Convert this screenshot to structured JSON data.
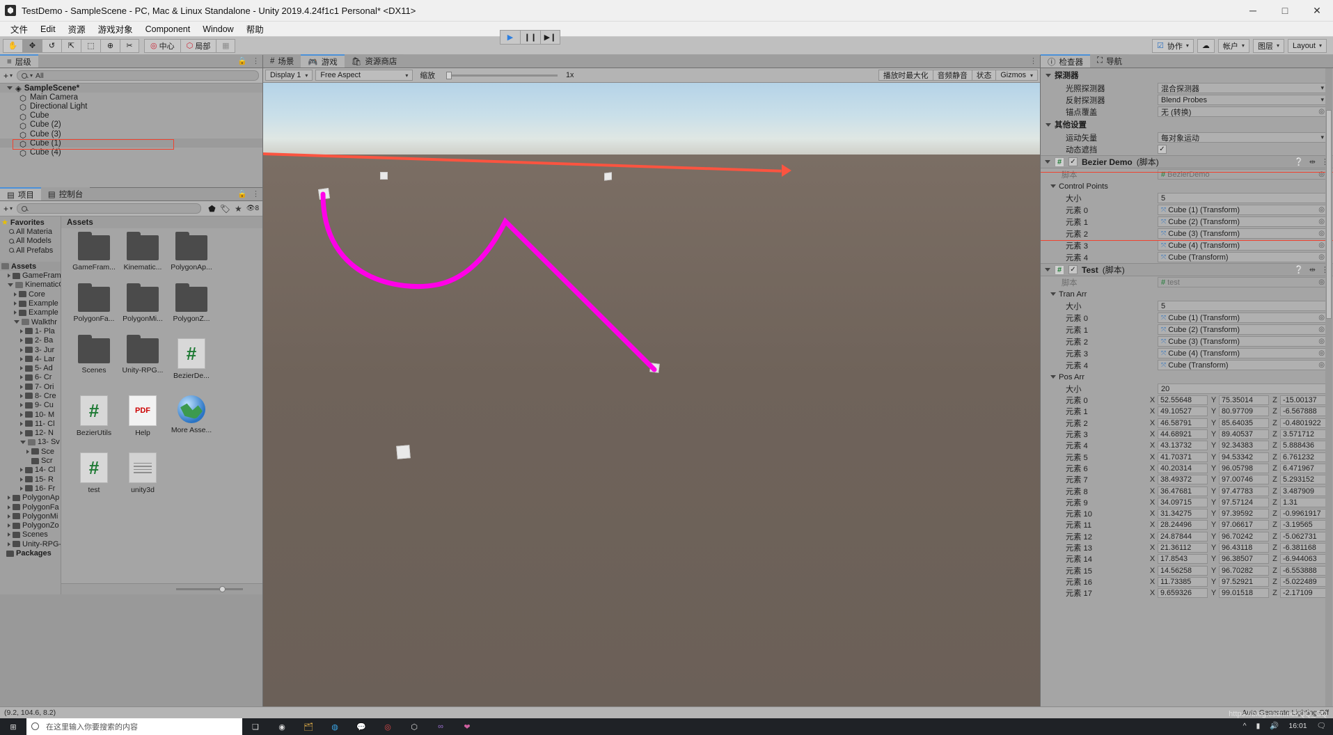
{
  "window": {
    "title": "TestDemo - SampleScene - PC, Mac & Linux Standalone - Unity 2019.4.24f1c1 Personal* <DX11>",
    "minimize": "─",
    "maximize": "□",
    "close": "✕"
  },
  "menubar": [
    "文件",
    "Edit",
    "资源",
    "游戏对象",
    "Component",
    "Window",
    "帮助"
  ],
  "toolbar": {
    "tools": [
      "hand-tool",
      "move-tool",
      "rotate-tool",
      "scale-tool",
      "rect-tool",
      "transform-tool",
      "custom-tool"
    ],
    "pivot": "中心",
    "space": "局部",
    "snap": "snap",
    "play": "▶",
    "pause": "❙❙",
    "step": "▶❙",
    "collab": "协作",
    "cloud": "cloud",
    "account": "帐户",
    "layers": "图层",
    "layout": "Layout"
  },
  "hierarchy": {
    "tab": "层级",
    "add_label": "+",
    "search_placeholder": "All",
    "scene": "SampleScene*",
    "items": [
      {
        "label": "Main Camera",
        "selected": false
      },
      {
        "label": "Directional Light",
        "selected": false
      },
      {
        "label": "Cube",
        "selected": false
      },
      {
        "label": "Cube (2)",
        "selected": false
      },
      {
        "label": "Cube (3)",
        "selected": false
      },
      {
        "label": "Cube (1)",
        "selected": true
      },
      {
        "label": "Cube (4)",
        "selected": false
      }
    ]
  },
  "project": {
    "tabs": [
      {
        "label": "项目",
        "active": true
      },
      {
        "label": "控制台",
        "active": false
      }
    ],
    "search_placeholder": "",
    "count_badge": "8",
    "breadcrumb": "Assets",
    "favorites_label": "Favorites",
    "favorites": [
      "All Materia",
      "All Models",
      "All Prefabs"
    ],
    "tree": [
      {
        "label": "Assets",
        "depth": 0,
        "arrow": "open-folder",
        "bold": true,
        "selected": true
      },
      {
        "label": "GameFram",
        "depth": 1,
        "arrow": "closed"
      },
      {
        "label": "KinematicC",
        "depth": 1,
        "arrow": "open"
      },
      {
        "label": "Core",
        "depth": 2,
        "arrow": "closed"
      },
      {
        "label": "Example",
        "depth": 2,
        "arrow": "closed"
      },
      {
        "label": "Example",
        "depth": 2,
        "arrow": "closed"
      },
      {
        "label": "Walkthr",
        "depth": 2,
        "arrow": "open"
      },
      {
        "label": "1- Pla",
        "depth": 3,
        "arrow": "closed"
      },
      {
        "label": "2- Ba",
        "depth": 3,
        "arrow": "closed"
      },
      {
        "label": "3- Jur",
        "depth": 3,
        "arrow": "closed"
      },
      {
        "label": "4- Lar",
        "depth": 3,
        "arrow": "closed"
      },
      {
        "label": "5- Ad",
        "depth": 3,
        "arrow": "closed"
      },
      {
        "label": "6- Cr",
        "depth": 3,
        "arrow": "closed"
      },
      {
        "label": "7- Ori",
        "depth": 3,
        "arrow": "closed"
      },
      {
        "label": "8- Cre",
        "depth": 3,
        "arrow": "closed"
      },
      {
        "label": "9- Cu",
        "depth": 3,
        "arrow": "closed"
      },
      {
        "label": "10- M",
        "depth": 3,
        "arrow": "closed"
      },
      {
        "label": "11- Cl",
        "depth": 3,
        "arrow": "closed"
      },
      {
        "label": "12- N",
        "depth": 3,
        "arrow": "closed"
      },
      {
        "label": "13- Sv",
        "depth": 3,
        "arrow": "open"
      },
      {
        "label": "Sce",
        "depth": 4,
        "arrow": "closed"
      },
      {
        "label": "Scr",
        "depth": 4,
        "arrow": "none"
      },
      {
        "label": "14- Cl",
        "depth": 3,
        "arrow": "closed"
      },
      {
        "label": "15- R",
        "depth": 3,
        "arrow": "closed"
      },
      {
        "label": "16- Fr",
        "depth": 3,
        "arrow": "closed"
      },
      {
        "label": "PolygonAp",
        "depth": 1,
        "arrow": "closed"
      },
      {
        "label": "PolygonFa",
        "depth": 1,
        "arrow": "closed"
      },
      {
        "label": "PolygonMi",
        "depth": 1,
        "arrow": "closed"
      },
      {
        "label": "PolygonZo",
        "depth": 1,
        "arrow": "closed"
      },
      {
        "label": "Scenes",
        "depth": 1,
        "arrow": "closed"
      },
      {
        "label": "Unity-RPG-",
        "depth": 1,
        "arrow": "closed"
      },
      {
        "label": "Packages",
        "depth": 0,
        "arrow": "none",
        "bold": true
      }
    ],
    "assets": [
      {
        "label": "GameFram...",
        "type": "folder"
      },
      {
        "label": "Kinematic...",
        "type": "folder"
      },
      {
        "label": "PolygonAp...",
        "type": "folder"
      },
      {
        "label": "PolygonFa...",
        "type": "folder"
      },
      {
        "label": "PolygonMi...",
        "type": "folder"
      },
      {
        "label": "PolygonZ...",
        "type": "folder"
      },
      {
        "label": "Scenes",
        "type": "folder"
      },
      {
        "label": "Unity-RPG...",
        "type": "folder"
      },
      {
        "label": "BezierDe...",
        "type": "script",
        "glyph": "#"
      },
      {
        "label": "BezierUtils",
        "type": "script",
        "glyph": "#"
      },
      {
        "label": "Help",
        "type": "pdf",
        "glyph": "PDF"
      },
      {
        "label": "More Asse...",
        "type": "globe"
      },
      {
        "label": "test",
        "type": "script",
        "glyph": "#"
      },
      {
        "label": "unity3d",
        "type": "text"
      }
    ]
  },
  "gameview": {
    "tabs": [
      {
        "label": "场景",
        "icon": "grid-icon",
        "active": false
      },
      {
        "label": "游戏",
        "icon": "gamepad-icon",
        "active": true
      },
      {
        "label": "资源商店",
        "icon": "store-icon",
        "active": false
      }
    ],
    "display": "Display 1",
    "aspect": "Free Aspect",
    "scale_label": "缩放",
    "scale_value": "1x",
    "maximize_on_play": "播放时最大化",
    "mute_audio": "音频静音",
    "stats": "状态",
    "gizmos": "Gizmos"
  },
  "inspector": {
    "tabs": [
      {
        "label": "检查器",
        "icon": "info-icon",
        "active": true
      },
      {
        "label": "导航",
        "icon": "nav-icon",
        "active": false
      }
    ],
    "sections": [
      {
        "title": "探测器",
        "rows": [
          {
            "label": "光照探测器",
            "value": "混合探测器",
            "kind": "dropdown"
          },
          {
            "label": "反射探测器",
            "value": "Blend Probes",
            "kind": "dropdown"
          },
          {
            "label": "锚点覆盖",
            "value": "无 (转换)",
            "kind": "object"
          }
        ]
      },
      {
        "title": "其他设置",
        "rows": [
          {
            "label": "运动矢量",
            "value": "每对象运动",
            "kind": "dropdown"
          },
          {
            "label": "动态遮挡",
            "value": "✓",
            "kind": "checkbox"
          }
        ]
      }
    ],
    "bezier": {
      "component_name": "Bezier Demo",
      "component_suffix": "(脚本)",
      "script_label": "脚本",
      "script_value": "BezierDemo",
      "array_label": "Control Points",
      "size_label": "大小",
      "size_value": "5",
      "elements": [
        {
          "label": "元素 0",
          "value": "Cube (1) (Transform)"
        },
        {
          "label": "元素 1",
          "value": "Cube (2) (Transform)"
        },
        {
          "label": "元素 2",
          "value": "Cube (3) (Transform)"
        },
        {
          "label": "元素 3",
          "value": "Cube (4) (Transform)"
        },
        {
          "label": "元素 4",
          "value": "Cube (Transform)"
        }
      ]
    },
    "test": {
      "component_name": "Test",
      "component_suffix": "(脚本)",
      "script_label": "脚本",
      "script_value": "test",
      "tran_arr_label": "Tran Arr",
      "tran_size_label": "大小",
      "tran_size_value": "5",
      "tran_elements": [
        {
          "label": "元素 0",
          "value": "Cube (1) (Transform)"
        },
        {
          "label": "元素 1",
          "value": "Cube (2) (Transform)"
        },
        {
          "label": "元素 2",
          "value": "Cube (3) (Transform)"
        },
        {
          "label": "元素 3",
          "value": "Cube (4) (Transform)"
        },
        {
          "label": "元素 4",
          "value": "Cube (Transform)"
        }
      ],
      "pos_arr_label": "Pos Arr",
      "pos_size_label": "大小",
      "pos_size_value": "20",
      "axes": [
        "X",
        "Y",
        "Z"
      ],
      "pos_elements": [
        {
          "label": "元素 0",
          "x": "52.55648",
          "y": "75.35014",
          "z": "-15.00137"
        },
        {
          "label": "元素 1",
          "x": "49.10527",
          "y": "80.97709",
          "z": "-6.567888"
        },
        {
          "label": "元素 2",
          "x": "46.58791",
          "y": "85.64035",
          "z": "-0.4801922"
        },
        {
          "label": "元素 3",
          "x": "44.68921",
          "y": "89.40537",
          "z": "3.571712"
        },
        {
          "label": "元素 4",
          "x": "43.13732",
          "y": "92.34383",
          "z": "5.888436"
        },
        {
          "label": "元素 5",
          "x": "41.70371",
          "y": "94.53342",
          "z": "6.761232"
        },
        {
          "label": "元素 6",
          "x": "40.20314",
          "y": "96.05798",
          "z": "6.471967"
        },
        {
          "label": "元素 7",
          "x": "38.49372",
          "y": "97.00746",
          "z": "5.293152"
        },
        {
          "label": "元素 8",
          "x": "36.47681",
          "y": "97.47783",
          "z": "3.487909"
        },
        {
          "label": "元素 9",
          "x": "34.09715",
          "y": "97.57124",
          "z": "1.31"
        },
        {
          "label": "元素 10",
          "x": "31.34275",
          "y": "97.39592",
          "z": "-0.9961917"
        },
        {
          "label": "元素 11",
          "x": "28.24496",
          "y": "97.06617",
          "z": "-3.19565"
        },
        {
          "label": "元素 12",
          "x": "24.87844",
          "y": "96.70242",
          "z": "-5.062731"
        },
        {
          "label": "元素 13",
          "x": "21.36112",
          "y": "96.43118",
          "z": "-6.381168"
        },
        {
          "label": "元素 14",
          "x": "17.8543",
          "y": "96.38507",
          "z": "-6.944063"
        },
        {
          "label": "元素 15",
          "x": "14.56258",
          "y": "96.70282",
          "z": "-6.553888"
        },
        {
          "label": "元素 16",
          "x": "11.73385",
          "y": "97.52921",
          "z": "-5.022489"
        },
        {
          "label": "元素 17",
          "x": "9.659326",
          "y": "99.01518",
          "z": "-2.17109"
        }
      ]
    }
  },
  "statusbar": {
    "coords": "(9.2, 104.6, 8.2)",
    "lighting": "Auto Generate Lighting Off"
  },
  "taskbar": {
    "search_placeholder": "在这里输入你要搜索的内容",
    "clock_time": "16:01",
    "clock_date": ""
  },
  "watermark": "https://blog.csdn.net/QQ_GQ",
  "colors": {
    "accent_blue": "#4a90d9",
    "annotation_red": "#fb5440",
    "curve_magenta": "#ff00e8",
    "script_green": "#1e7a34"
  }
}
